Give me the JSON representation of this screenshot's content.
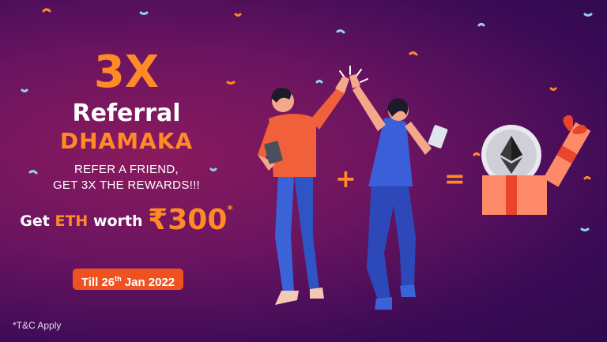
{
  "headline": {
    "multiplier": "3X",
    "line1": "Referral",
    "line2": "DHAMAKA"
  },
  "subline": {
    "line1": "REFER A FRIEND,",
    "line2": "GET 3X THE REWARDS!!!"
  },
  "offer": {
    "prefix": "Get",
    "coin": "ETH",
    "middle": "worth",
    "amount": "₹300",
    "asterisk": "*"
  },
  "deadline": {
    "prefix": "Till 26",
    "ordinal": "th",
    "suffix": " Jan 2022"
  },
  "terms": "*T&C Apply",
  "equation": {
    "plus": "+",
    "equals": "="
  },
  "icons": [
    "ethereum-icon",
    "gift-box-icon",
    "confetti-icon",
    "phone-icon"
  ],
  "colors": {
    "accent": "#ff8a26",
    "pill": "#f0521f",
    "background_start": "#8a1a5e",
    "background_end": "#2d0a4e"
  }
}
